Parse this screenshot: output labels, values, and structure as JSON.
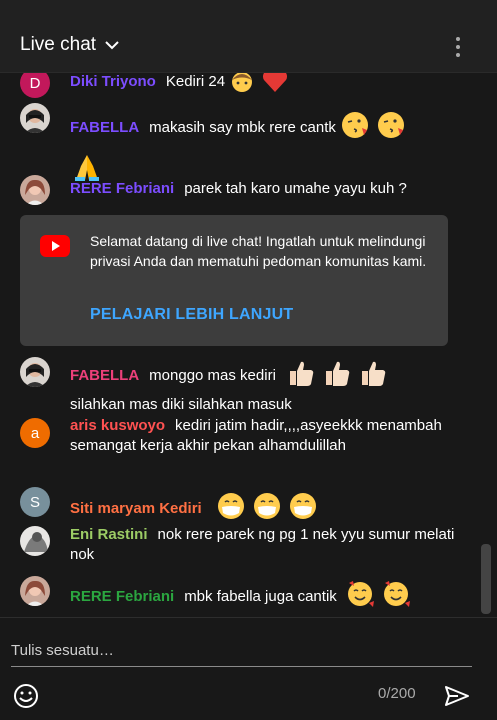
{
  "header": {
    "title": "Live chat"
  },
  "messages": [
    {
      "author": "Diki Triyono",
      "author_color": "#7c4dff",
      "text": "Kediri 24",
      "emojis": [
        "boy",
        "heart"
      ],
      "avatar": {
        "type": "letter",
        "letter": "D",
        "bg": "#c2185b"
      }
    },
    {
      "author": "FABELLA",
      "author_color": "#7c4dff",
      "text": "makasih say mbk rere cantk",
      "emojis": [
        "kiss",
        "kiss",
        "pray"
      ],
      "avatar": {
        "type": "photo",
        "bg": "#d9d4cf"
      }
    },
    {
      "author": "RERE Febriani",
      "author_color": "#7c4dff",
      "text": "parek tah karo umahe yayu kuh ?",
      "avatar": {
        "type": "photo",
        "bg": "#c9a89a"
      }
    },
    {
      "author": "FABELLA",
      "author_color": "#ec407a",
      "text": "monggo mas kediri",
      "emojis": [
        "thumb",
        "thumb",
        "thumb"
      ],
      "text2": "silahkan mas diki silahkan masuk",
      "avatar": {
        "type": "photo",
        "bg": "#d9d4cf"
      }
    },
    {
      "author": "aris kuswoyo",
      "author_color": "#ff5252",
      "text": "kediri jatim hadir,,,,asyeekkk menambah semangat kerja akhir pekan alhamdulillah",
      "avatar": {
        "type": "letter",
        "letter": "a",
        "bg": "#ef6c00"
      }
    },
    {
      "author": "Siti maryam Kediri",
      "author_color": "#ff7043",
      "text": "",
      "emojis": [
        "mask",
        "mask",
        "mask"
      ],
      "avatar": {
        "type": "letter",
        "letter": "S",
        "bg": "#78909c"
      }
    },
    {
      "author": "Eni Rastini",
      "author_color": "#9ccc65",
      "text": "nok rere parek ng pg 1 nek yyu sumur melati nok",
      "avatar": {
        "type": "photo",
        "bg": "#e8e6e4"
      }
    },
    {
      "author": "RERE Febriani",
      "author_color": "#2ba640",
      "text": "mbk fabella juga cantik",
      "emojis": [
        "love",
        "love"
      ],
      "avatar": {
        "type": "photo",
        "bg": "#c9a89a"
      }
    }
  ],
  "banner": {
    "text": "Selamat datang di live chat! Ingatlah untuk melindungi privasi Anda dan mematuhi pedoman komunitas kami.",
    "link": "PELAJARI LEBIH LANJUT",
    "icon_color": "#ff0000"
  },
  "composer": {
    "placeholder": "Tulis sesuatu…",
    "counter": "0/200"
  },
  "icons": {
    "title": "chevron-down",
    "menu": "more-vertical",
    "banner": "youtube",
    "emoji": "smiley",
    "send": "send-arrow"
  }
}
